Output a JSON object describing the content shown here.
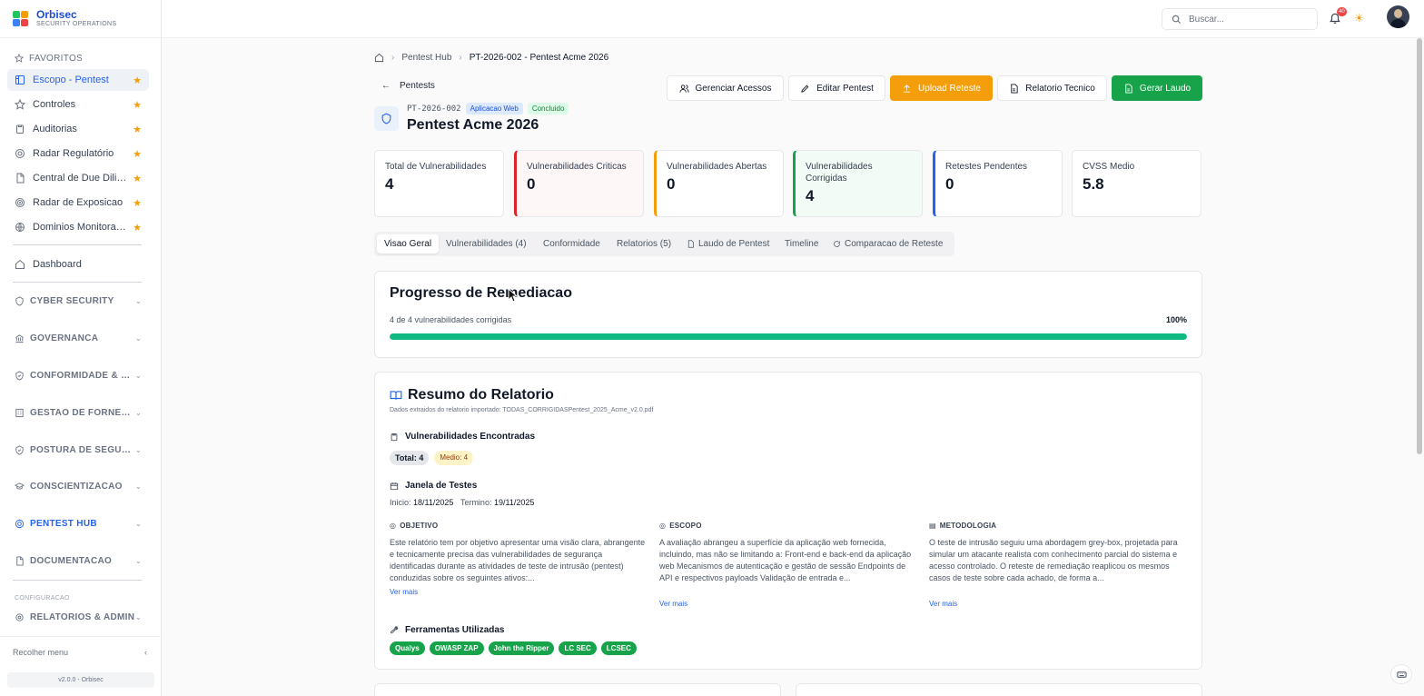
{
  "brand": {
    "name": "Orbisec",
    "subtitle": "SECURITY OPERATIONS"
  },
  "sidebar": {
    "favorites_label": "FAVORITOS",
    "favorites": [
      {
        "label": "Escopo - Pentest",
        "icon": "layout-icon",
        "active": true
      },
      {
        "label": "Controles",
        "icon": "star-outline-icon"
      },
      {
        "label": "Auditorias",
        "icon": "clipboard-icon"
      },
      {
        "label": "Radar Regulatório",
        "icon": "radar-icon"
      },
      {
        "label": "Central de Due Dilige...",
        "icon": "file-icon"
      },
      {
        "label": "Radar de Exposicao",
        "icon": "target-icon"
      },
      {
        "label": "Dominios Monitorados",
        "icon": "globe-icon"
      }
    ],
    "dashboard": "Dashboard",
    "sections": [
      "CYBER SECURITY",
      "GOVERNANCA",
      "CONFORMIDADE & RIS...",
      "GESTAO DE FORNECE...",
      "POSTURA DE SEGURA...",
      "CONSCIENTIZACAO",
      "PENTEST HUB",
      "DOCUMENTACAO"
    ],
    "config_label": "CONFIGURACAO",
    "config_section": "RELATORIOS & ADMIN",
    "collapse": "Recolher menu",
    "version": "v2.0.0 - Orbisec"
  },
  "topbar": {
    "search_placeholder": "Buscar...",
    "notifications": "40"
  },
  "breadcrumb": {
    "items": [
      "Pentest Hub",
      "PT-2026-002 - Pentest Acme 2026"
    ]
  },
  "back_label": "Pentests",
  "header": {
    "code": "PT-2026-002",
    "type_tag": "Aplicacao Web",
    "status_tag": "Concluido",
    "title": "Pentest Acme 2026"
  },
  "actions": {
    "manage": "Gerenciar Acessos",
    "edit": "Editar Pentest",
    "upload": "Upload Reteste",
    "report": "Relatorio Tecnico",
    "generate": "Gerar Laudo"
  },
  "stats": [
    {
      "label": "Total de Vulnerabilidades",
      "value": "4"
    },
    {
      "label": "Vulnerabilidades Criticas",
      "value": "0"
    },
    {
      "label": "Vulnerabilidades Abertas",
      "value": "0"
    },
    {
      "label": "Vulnerabilidades Corrigidas",
      "value": "4"
    },
    {
      "label": "Retestes Pendentes",
      "value": "0"
    },
    {
      "label": "CVSS Medio",
      "value": "5.8"
    }
  ],
  "tabs": [
    "Visao Geral",
    "Vulnerabilidades (4)",
    "Conformidade",
    "Relatorios (5)",
    "Laudo de Pentest",
    "Timeline",
    "Comparacao de Reteste"
  ],
  "progress": {
    "title": "Progresso de Remediacao",
    "text": "4 de 4 vulnerabilidades corrigidas",
    "percent_label": "100%",
    "fraction": 1.0,
    "color": "#10b981"
  },
  "summary": {
    "title": "Resumo do Relatorio",
    "subtitle": "Dados extraidos do relatorio importado: TODAS_CORRIGIDASPentest_2025_Acme_v2.0.pdf",
    "vulns_heading": "Vulnerabilidades Encontradas",
    "total_pill": "Total: 4",
    "medium_pill": "Medio: 4",
    "window_heading": "Janela de Testes",
    "start_label": "Inicio:",
    "start_date": "18/11/2025",
    "end_label": "Termino:",
    "end_date": "19/11/2025",
    "objective": {
      "heading": "OBJETIVO",
      "text": "Este relatório tem por objetivo apresentar uma visão clara, abrangente e tecnicamente precisa das vulnerabilidades de segurança identificadas durante as atividades de teste de intrusão (pentest) conduzidas sobre os seguintes ativos:..."
    },
    "scope": {
      "heading": "ESCOPO",
      "text": "A avaliação abrangeu a superfície da aplicação web fornecida, incluindo, mas não se limitando a: Front-end e back-end da aplicação web Mecanismos de autenticação e gestão de sessão Endpoints de API e respectivos payloads Validação de entrada e..."
    },
    "method": {
      "heading": "METODOLOGIA",
      "text": "O teste de intrusão seguiu uma abordagem grey-box, projetada para simular um atacante realista com conhecimento parcial do sistema e acesso controlado. O reteste de remediação reaplicou os mesmos casos de teste sobre cada achado, de forma a..."
    },
    "see_more": "Ver mais",
    "tools_heading": "Ferramentas Utilizadas",
    "tools": [
      "Qualys",
      "OWASP ZAP",
      "John the Ripper",
      "LC SEC",
      "LCSEC"
    ]
  }
}
